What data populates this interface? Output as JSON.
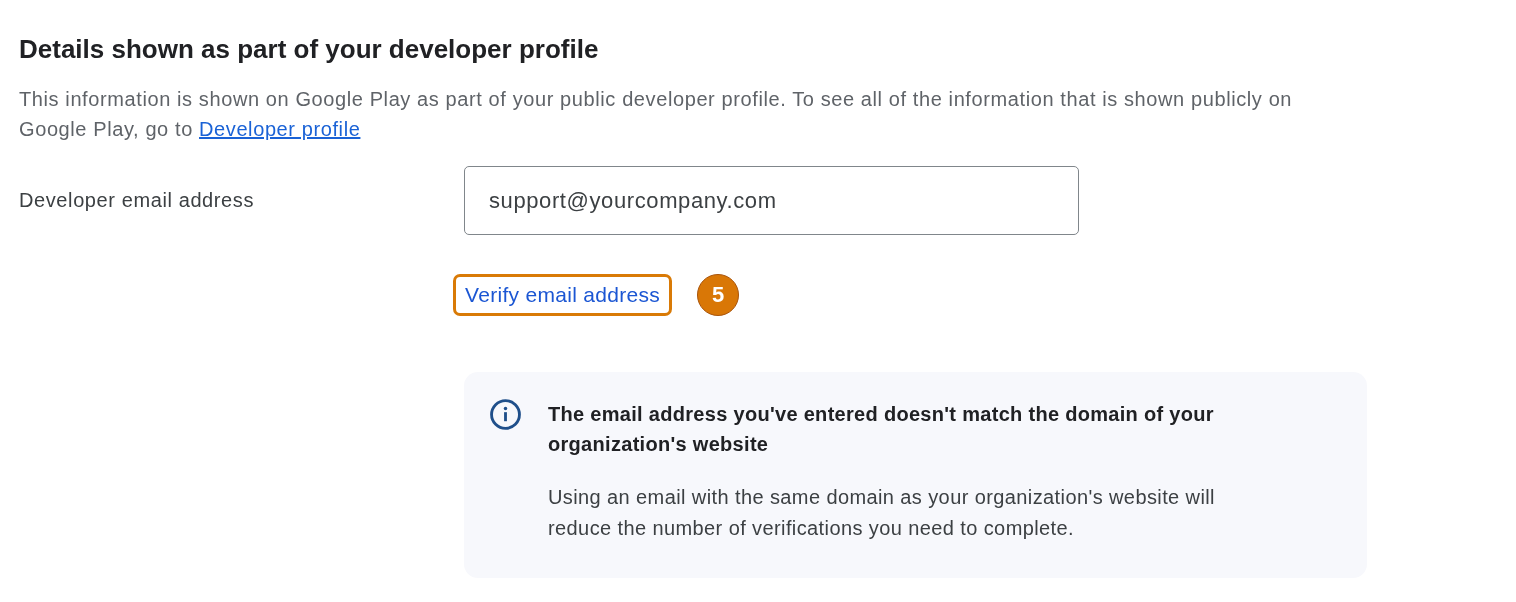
{
  "section": {
    "title": "Details shown as part of your developer profile",
    "description": {
      "text": "This information is shown on Google Play as part of your public developer profile. To see all of the information that is shown publicly on Google Play, go to",
      "link": "Developer profile"
    }
  },
  "email_field": {
    "label": "Developer email address",
    "value": "support@yourcompany.com"
  },
  "verify_link": {
    "label": "Verify email address",
    "highlighted": true,
    "step_marker": "5"
  },
  "notice": {
    "title": "The email address you've entered doesn't match the domain of your organization's website",
    "body": "Using an email with the same domain as your organization's website will reduce the number of verifications you need to complete."
  }
}
